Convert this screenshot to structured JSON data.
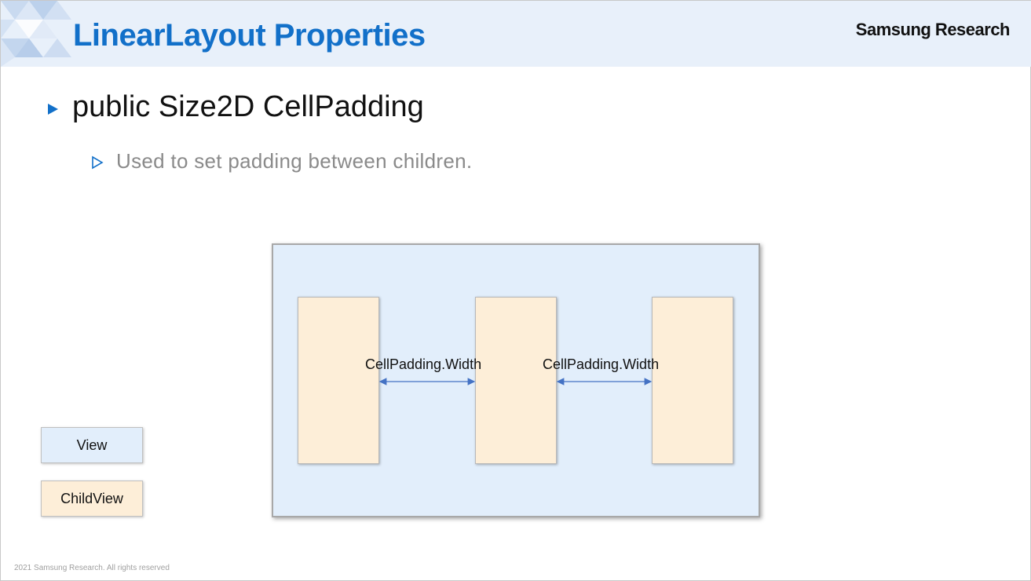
{
  "header": {
    "title": "LinearLayout Properties",
    "brand": "Samsung Research"
  },
  "bullets": {
    "main": "public Size2D CellPadding",
    "sub": "Used to set padding between children."
  },
  "diagram": {
    "padding_labels": [
      "CellPadding.Width",
      "CellPadding.Width"
    ]
  },
  "legend": {
    "view": "View",
    "child": "ChildView"
  },
  "footer": "2021 Samsung Research. All rights reserved",
  "colors": {
    "accent": "#1270c9",
    "header_bg": "#e8f0fa",
    "view_fill": "#e2eefb",
    "child_fill": "#fdeed8",
    "arrow": "#4472c4"
  },
  "icons": {
    "bullet_main": "filled-triangle-bullet-icon",
    "bullet_sub": "outline-triangle-bullet-icon",
    "header_decoration": "triangle-pattern-icon"
  }
}
